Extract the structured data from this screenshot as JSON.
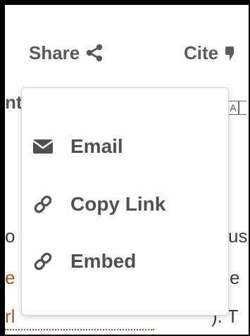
{
  "toolbar": {
    "share_label": "Share",
    "share_icon": "share-icon",
    "cite_label": "Cite",
    "cite_icon": "quote-icon"
  },
  "background": {
    "heading_fragment": "nting",
    "font_size_control": "A",
    "line_left_1": "o",
    "line_right_1": "us",
    "line_left_2": "e",
    "line_right_2": "e",
    "line_left_3": "rl",
    "line_right_3": "). T"
  },
  "share_menu": {
    "items": [
      {
        "label": "Email",
        "icon": "envelope-icon"
      },
      {
        "label": "Copy Link",
        "icon": "link-icon"
      },
      {
        "label": "Embed",
        "icon": "link-icon"
      }
    ]
  },
  "colors": {
    "icon_gray": "#505050",
    "link_orange": "#b0531b"
  }
}
